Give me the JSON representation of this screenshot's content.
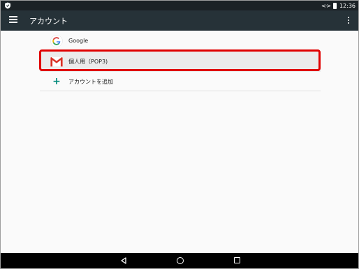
{
  "status_bar": {
    "time": "12:36",
    "sync_glyph": "<·>",
    "left_icon": "shield-icon",
    "battery_icon": "battery-icon"
  },
  "app_bar": {
    "title": "アカウント",
    "menu_icon": "hamburger-menu-icon",
    "overflow_icon": "more-vert-icon"
  },
  "accounts": [
    {
      "label": "Google",
      "icon": "google-logo-icon",
      "selected": false
    },
    {
      "label": "個人用（POP3)",
      "icon": "gmail-logo-icon",
      "selected": true
    }
  ],
  "add_account": {
    "label": "アカウントを追加",
    "icon": "plus-icon",
    "color": "#00897b"
  },
  "nav_bar": {
    "back_icon": "back-icon",
    "home_icon": "home-icon",
    "recent_icon": "recent-apps-icon"
  },
  "colors": {
    "status_bar": "#1c2226",
    "app_bar": "#263238",
    "highlight": "#e00000",
    "selected_row": "#ebebeb"
  }
}
